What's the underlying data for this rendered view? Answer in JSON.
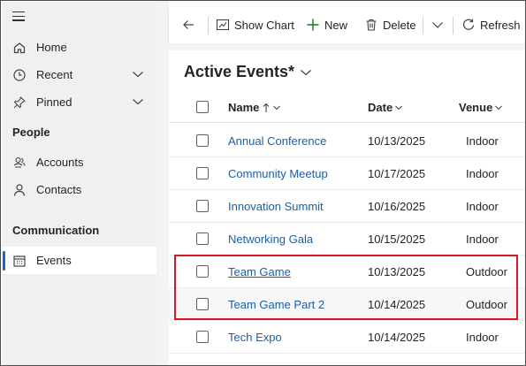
{
  "sidebar": {
    "items": [
      {
        "label": "Home",
        "icon": "home-icon"
      },
      {
        "label": "Recent",
        "icon": "clock-icon"
      },
      {
        "label": "Pinned",
        "icon": "pin-icon"
      }
    ],
    "sections": [
      {
        "title": "People",
        "items": [
          {
            "label": "Accounts",
            "icon": "accounts-icon"
          },
          {
            "label": "Contacts",
            "icon": "contact-icon"
          }
        ]
      },
      {
        "title": "Communication",
        "items": [
          {
            "label": "Events",
            "icon": "calendar-icon",
            "selected": true
          }
        ]
      }
    ]
  },
  "toolbar": {
    "back_icon": "back-arrow-icon",
    "show_chart": "Show Chart",
    "new": "New",
    "delete": "Delete",
    "refresh": "Refresh"
  },
  "view": {
    "title": "Active Events*"
  },
  "grid": {
    "columns": [
      "Name",
      "Date",
      "Venue"
    ],
    "sort": {
      "column": "Name",
      "direction": "ascending"
    },
    "rows": [
      {
        "name": "Annual Conference",
        "date": "10/13/2025",
        "venue": "Indoor"
      },
      {
        "name": "Community Meetup",
        "date": "10/17/2025",
        "venue": "Indoor"
      },
      {
        "name": "Innovation Summit",
        "date": "10/16/2025",
        "venue": "Indoor"
      },
      {
        "name": "Networking Gala",
        "date": "10/15/2025",
        "venue": "Indoor"
      },
      {
        "name": "Team Game",
        "date": "10/13/2025",
        "venue": "Outdoor"
      },
      {
        "name": "Team Game Part 2",
        "date": "10/14/2025",
        "venue": "Outdoor"
      },
      {
        "name": "Tech Expo",
        "date": "10/14/2025",
        "venue": "Indoor"
      }
    ]
  },
  "colors": {
    "accent": "#0f6cbd",
    "link": "#1b5fa8",
    "highlight_border": "#d41920",
    "sidebar_bg": "#f0f0f0"
  }
}
